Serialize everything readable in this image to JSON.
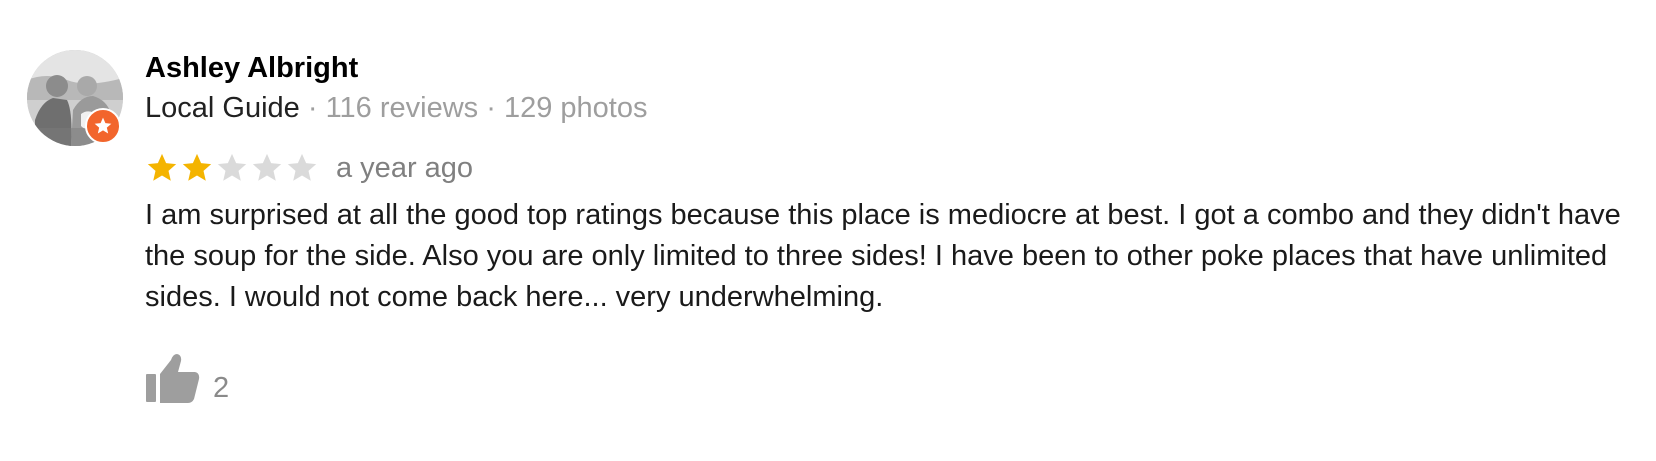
{
  "review": {
    "author_name": "Ashley Albright",
    "guide_label": "Local Guide",
    "separator": " · ",
    "review_count": "116 reviews",
    "photo_count": "129 photos",
    "rating": 2,
    "rating_max": 5,
    "date": "a year ago",
    "text": "I am surprised at all the good top ratings because this place is mediocre at best. I got a combo and they didn't have the soup for the side. Also you are only limited to three sides! I have been to other poke places that have unlimited sides. I would not come back here... very underwhelming.",
    "likes": "2"
  },
  "icons": {
    "avatar": "profile-photo",
    "badge": "local-guide-star-icon",
    "star_filled": "star-filled-icon",
    "star_empty": "star-empty-icon",
    "like": "thumbs-up-icon"
  },
  "colors": {
    "star_filled": "#f4b400",
    "star_empty": "#dadada",
    "badge": "#f2652c",
    "muted_text": "#9e9e9e",
    "like_icon": "#9e9e9e"
  }
}
